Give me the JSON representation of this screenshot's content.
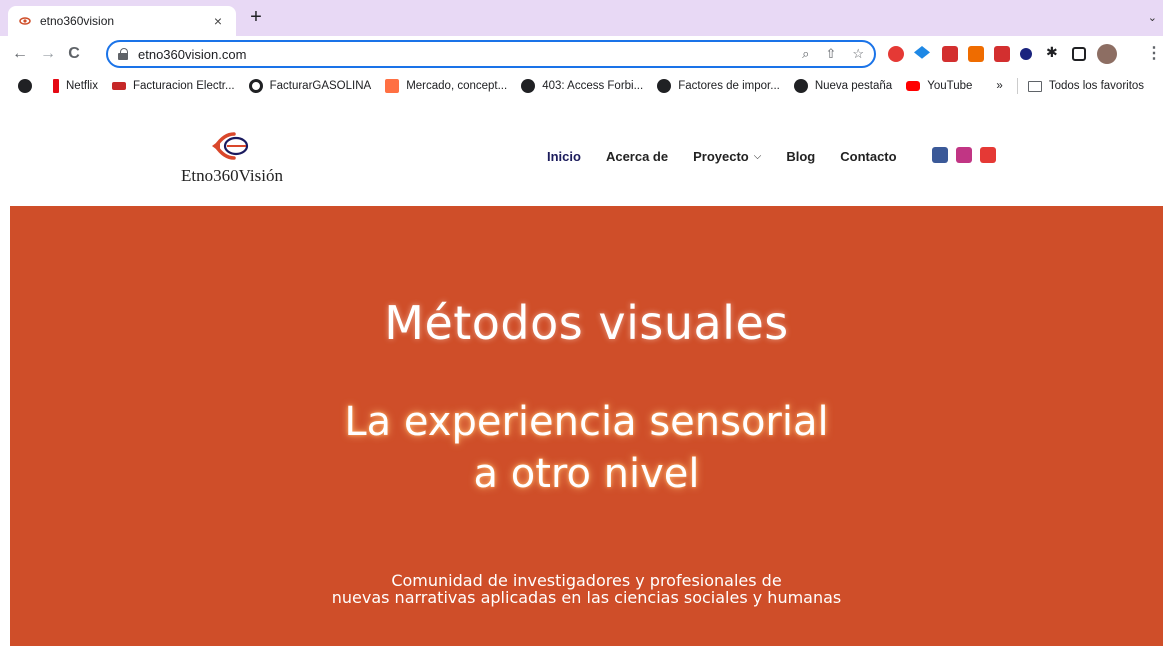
{
  "browser": {
    "tab_title": "etno360vision",
    "tab_close": "×",
    "new_tab": "+",
    "tab_menu": "⌄",
    "url": "etno360vision.com"
  },
  "bookmarks": [
    {
      "label": "",
      "icon": "chrome-globe-icon"
    },
    {
      "label": "Netflix",
      "icon": "netflix-icon"
    },
    {
      "label": "Facturacion Electr...",
      "icon": "invoice-icon"
    },
    {
      "label": "FacturarGASOLINA",
      "icon": "globe-icon"
    },
    {
      "label": "Mercado, concept...",
      "icon": "x-icon"
    },
    {
      "label": "403: Access Forbi...",
      "icon": "globe-icon"
    },
    {
      "label": "Factores de impor...",
      "icon": "globe-icon"
    },
    {
      "label": "Nueva pestaña",
      "icon": "globe-icon"
    },
    {
      "label": "YouTube",
      "icon": "youtube-icon"
    }
  ],
  "bookmarks_overflow": "»",
  "bookmarks_folder": "Todos los favoritos",
  "site": {
    "brand": "Etno360Visión",
    "nav": [
      "Inicio",
      "Acerca de",
      "Proyecto",
      "Blog",
      "Contacto"
    ],
    "social": [
      "facebook-icon",
      "instagram-icon",
      "youtube-icon"
    ]
  },
  "hero": {
    "title": "Métodos visuales",
    "subtitle_line1": "La experiencia sensorial",
    "subtitle_line2": "a otro nivel",
    "tagline_line1": "Comunidad de investigadores y profesionales de",
    "tagline_line2": "nuevas narrativas aplicadas en las ciencias sociales y humanas"
  },
  "colors": {
    "hero_bg": "#cf4e29",
    "tab_strip": "#e8d9f5",
    "omnibox_border": "#1a73e8"
  }
}
